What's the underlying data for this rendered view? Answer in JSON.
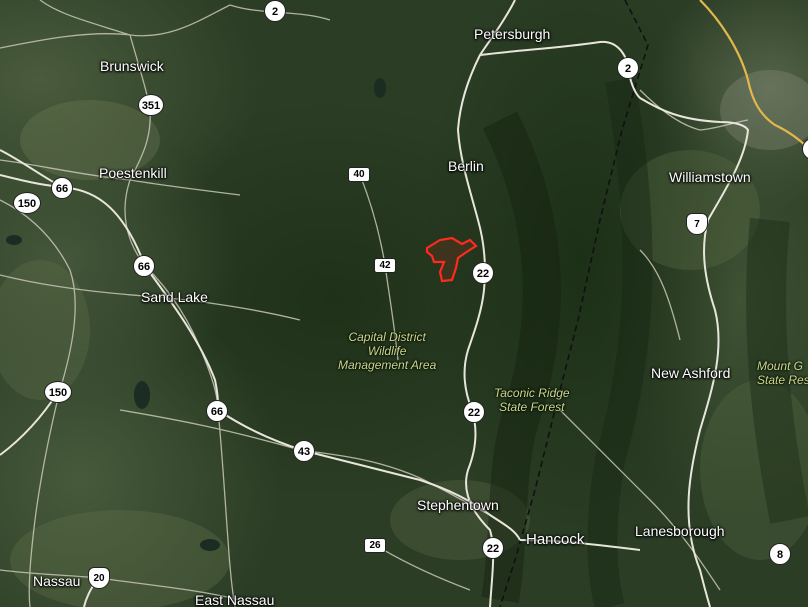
{
  "map": {
    "places": {
      "petersburgh": "Petersburgh",
      "brunswick": "Brunswick",
      "poestenkill": "Poestenkill",
      "berlin": "Berlin",
      "williamstown": "Williamstown",
      "sand_lake": "Sand Lake",
      "new_ashford": "New Ashford",
      "stephentown": "Stephentown",
      "hancock": "Hancock",
      "lanesborough": "Lanesborough",
      "nassau": "Nassau",
      "east_nassau": "East Nassau"
    },
    "areas": {
      "capital_district_line1": "Capital District",
      "capital_district_line2": "Wildlife",
      "capital_district_line3": "Management Area",
      "taconic_line1": "Taconic Ridge",
      "taconic_line2": "State Forest",
      "mount_greylock_line1": "Mount G",
      "mount_greylock_line2": "State Res"
    },
    "routes": {
      "r2_top": "2",
      "r2_right": "2",
      "r351": "351",
      "r40": "40",
      "r66_a": "66",
      "r150_a": "150",
      "r66_b": "66",
      "r42": "42",
      "r22_a": "22",
      "us7": "7",
      "r150_b": "150",
      "r66_c": "66",
      "r22_b": "22",
      "r43": "43",
      "r26": "26",
      "r22_c": "22",
      "us20": "20",
      "r8": "8"
    },
    "colors": {
      "forest": "#2b3d25",
      "road": "#c9c7b8",
      "major_road": "#e2b84a",
      "state_line": "#111111",
      "parcel": "#ff2a1f"
    }
  }
}
